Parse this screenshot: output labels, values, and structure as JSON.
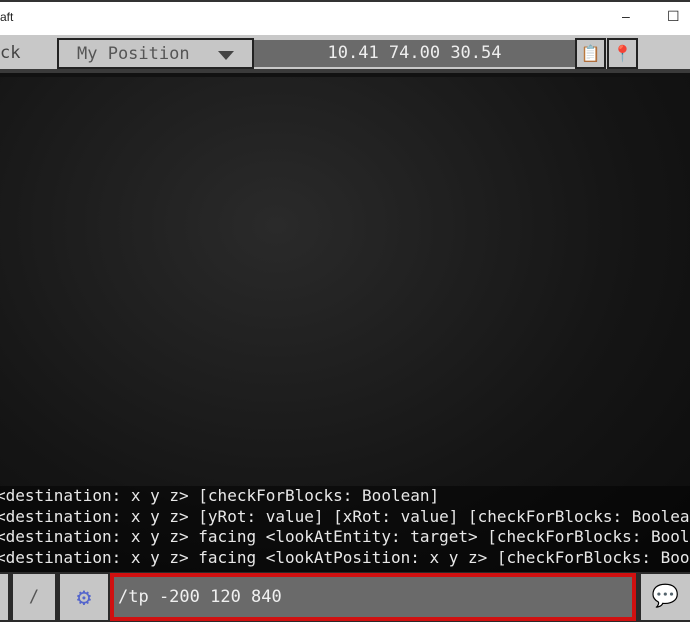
{
  "window": {
    "title": "aft",
    "minimize": "–",
    "maximize": "☐"
  },
  "toolbar": {
    "back_label": "ck",
    "position_dropdown": "My Position",
    "coordinates": "10.41 74.00 30.54",
    "icons": [
      "copy-icon",
      "teleport-location-icon"
    ]
  },
  "chat": {
    "lines": [
      "<destination: x y z> [checkForBlocks: Boolean]",
      "<destination: x y z> [yRot: value] [xRot: value] [checkForBlocks: Boolean]",
      "<destination: x y z> facing <lookAtEntity: target> [checkForBlocks: Boolean]",
      "<destination: x y z> facing <lookAtPosition: x y z> [checkForBlocks: Boolean]"
    ]
  },
  "bottom": {
    "slash_label": "/",
    "command_input": "/tp -200 120 840",
    "highlight_color": "#d01010"
  }
}
